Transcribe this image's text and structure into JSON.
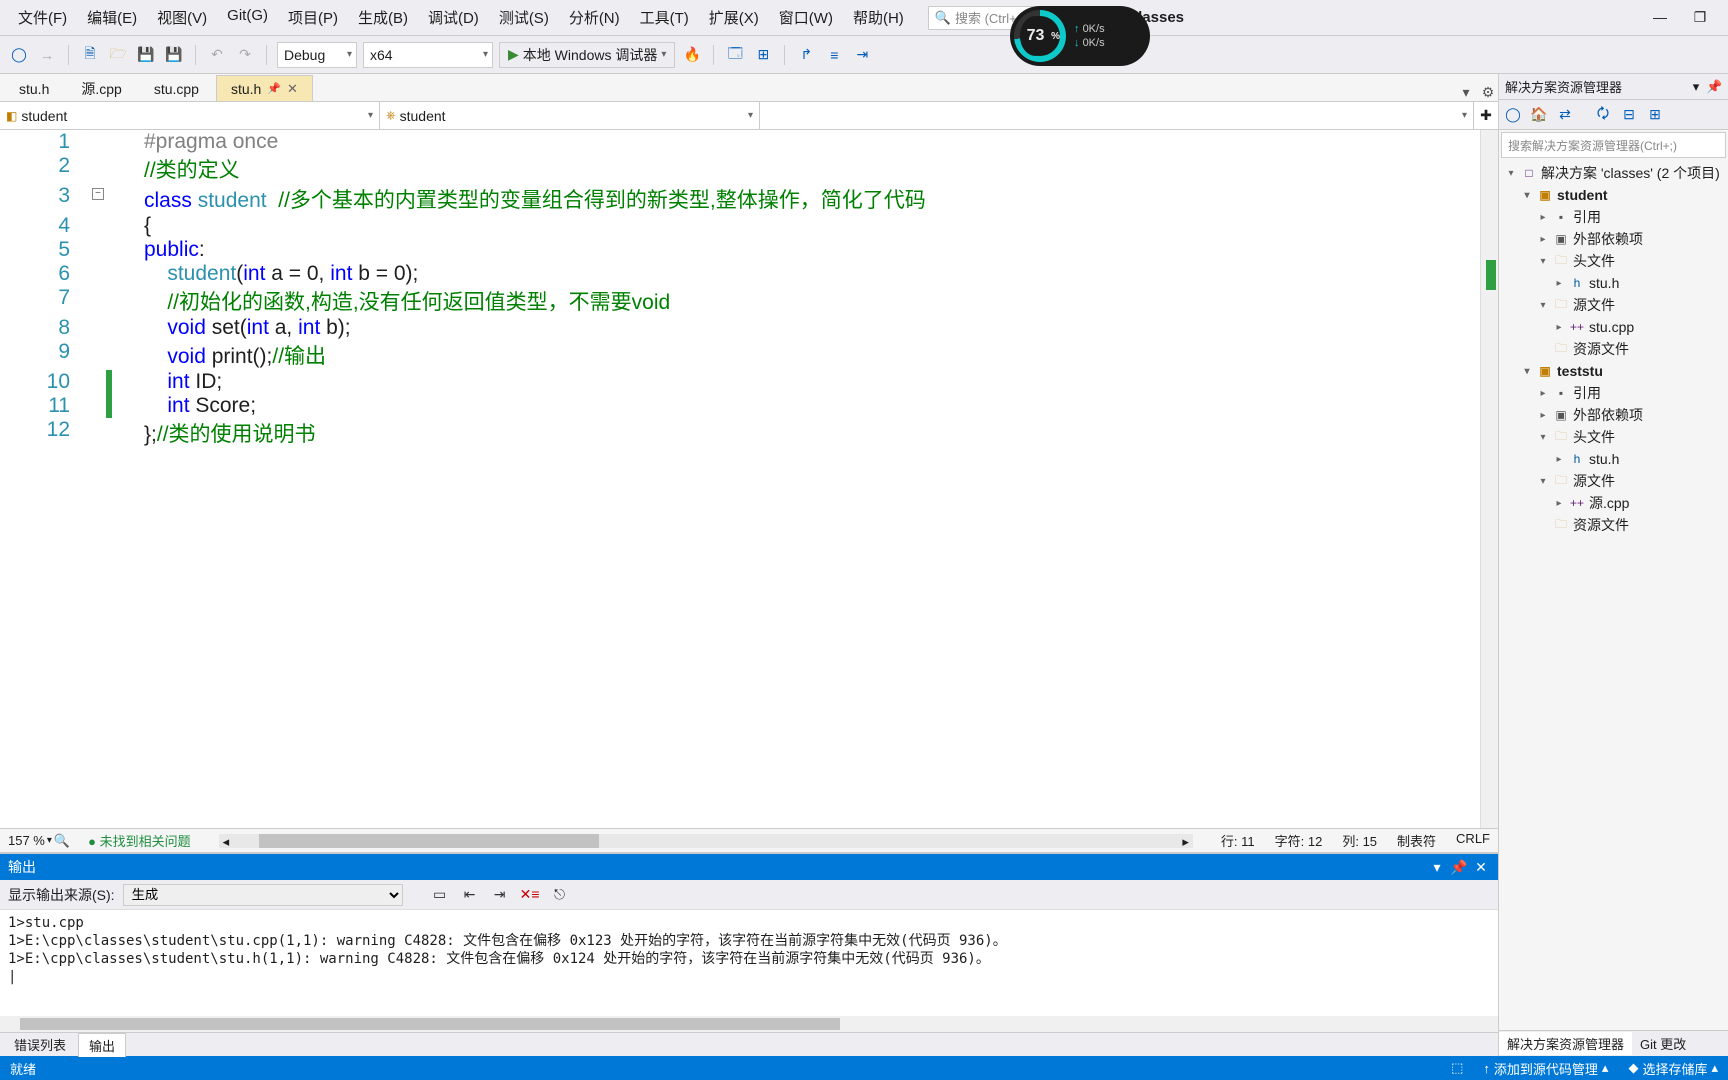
{
  "menu": [
    "文件(F)",
    "编辑(E)",
    "视图(V)",
    "Git(G)",
    "项目(P)",
    "生成(B)",
    "调试(D)",
    "测试(S)",
    "分析(N)",
    "工具(T)",
    "扩展(X)",
    "窗口(W)",
    "帮助(H)"
  ],
  "search_placeholder": "搜索 (Ctrl+Q)",
  "solution_name": "classes",
  "toolbar": {
    "config": "Debug",
    "platform": "x64",
    "debug_label": "本地 Windows 调试器"
  },
  "perf": {
    "pct": "73",
    "pct_unit": "%",
    "up": "0K/s",
    "down": "0K/s"
  },
  "editor_tabs": [
    {
      "label": "stu.h",
      "active": false
    },
    {
      "label": "源.cpp",
      "active": false
    },
    {
      "label": "stu.cpp",
      "active": false
    },
    {
      "label": "stu.h",
      "active": true
    }
  ],
  "nav": {
    "left": "student",
    "mid": "student",
    "right": ""
  },
  "code_lines": [
    {
      "n": 1,
      "html": "<span class='pp'>#pragma once</span>"
    },
    {
      "n": 2,
      "html": "<span class='com'>//类的定义</span>"
    },
    {
      "n": 3,
      "fold": true,
      "html": "<span class='kw'>class</span> <span class='type'>student</span>  <span class='com'>//多个基本的内置类型的变量组合得到的新类型,整体操作，简化了代码</span>"
    },
    {
      "n": 4,
      "html": "{"
    },
    {
      "n": 5,
      "html": "<span class='kw'>public</span>:"
    },
    {
      "n": 6,
      "html": "    <span class='type'>student</span>(<span class='kw'>int</span> a = 0, <span class='kw'>int</span> b = 0);"
    },
    {
      "n": 7,
      "html": "    <span class='com'>//初始化的函数,构造,没有任何返回值类型，不需要void</span>"
    },
    {
      "n": 8,
      "html": "    <span class='kw'>void</span> set(<span class='kw'>int</span> a, <span class='kw'>int</span> b);"
    },
    {
      "n": 9,
      "html": "    <span class='kw'>void</span> print();<span class='com'>//输出</span>"
    },
    {
      "n": 10,
      "change": true,
      "html": "    <span class='kw'>int</span> ID;"
    },
    {
      "n": 11,
      "change": true,
      "html": "    <span class='kw'>int</span> Score;"
    },
    {
      "n": 12,
      "html": "};<span class='com'>//类的使用说明书</span>"
    }
  ],
  "estatus": {
    "zoom": "157 %",
    "issues": "未找到相关问题",
    "line": "行: 11",
    "char": "字符: 12",
    "col": "列: 15",
    "ins": "制表符",
    "enc": "CRLF"
  },
  "output": {
    "title": "输出",
    "src_label": "显示输出来源(S):",
    "src_value": "生成",
    "lines": [
      "1>stu.cpp",
      "1>E:\\cpp\\classes\\student\\stu.cpp(1,1): warning C4828: 文件包含在偏移 0x123 处开始的字符，该字符在当前源字符集中无效(代码页 936)。",
      "1>E:\\cpp\\classes\\student\\stu.h(1,1): warning C4828: 文件包含在偏移 0x124 处开始的字符，该字符在当前源字符集中无效(代码页 936)。",
      "|"
    ]
  },
  "bottom_tabs": [
    {
      "label": "错误列表",
      "active": false
    },
    {
      "label": "输出",
      "active": true
    }
  ],
  "se": {
    "title": "解决方案资源管理器",
    "search": "搜索解决方案资源管理器(Ctrl+;)",
    "root": "解决方案 'classes' (2 个项目)",
    "tree": [
      {
        "d": 0,
        "arr": "▾",
        "ico": "□",
        "cls": "ico-sol",
        "label": "解决方案 'classes' (2 个项目)"
      },
      {
        "d": 1,
        "arr": "▾",
        "ico": "▣",
        "cls": "ico-proj",
        "label": "student",
        "bold": true
      },
      {
        "d": 2,
        "arr": "▸",
        "ico": "▪",
        "cls": "ico-ref",
        "label": "引用"
      },
      {
        "d": 2,
        "arr": "▸",
        "ico": "▣",
        "cls": "ico-ref",
        "label": "外部依赖项"
      },
      {
        "d": 2,
        "arr": "▾",
        "ico": "🗀",
        "cls": "ico-fold",
        "label": "头文件"
      },
      {
        "d": 3,
        "arr": "▸",
        "ico": "h",
        "cls": "ico-h",
        "label": "stu.h"
      },
      {
        "d": 2,
        "arr": "▾",
        "ico": "🗀",
        "cls": "ico-fold",
        "label": "源文件"
      },
      {
        "d": 3,
        "arr": "▸",
        "ico": "++",
        "cls": "ico-cpp",
        "label": "stu.cpp"
      },
      {
        "d": 2,
        "arr": "",
        "ico": "🗀",
        "cls": "ico-fold",
        "label": "资源文件"
      },
      {
        "d": 1,
        "arr": "▾",
        "ico": "▣",
        "cls": "ico-proj",
        "label": "teststu",
        "bold": true
      },
      {
        "d": 2,
        "arr": "▸",
        "ico": "▪",
        "cls": "ico-ref",
        "label": "引用"
      },
      {
        "d": 2,
        "arr": "▸",
        "ico": "▣",
        "cls": "ico-ref",
        "label": "外部依赖项"
      },
      {
        "d": 2,
        "arr": "▾",
        "ico": "🗀",
        "cls": "ico-fold",
        "label": "头文件"
      },
      {
        "d": 3,
        "arr": "▸",
        "ico": "h",
        "cls": "ico-h",
        "label": "stu.h"
      },
      {
        "d": 2,
        "arr": "▾",
        "ico": "🗀",
        "cls": "ico-fold",
        "label": "源文件"
      },
      {
        "d": 3,
        "arr": "▸",
        "ico": "++",
        "cls": "ico-cpp",
        "label": "源.cpp"
      },
      {
        "d": 2,
        "arr": "",
        "ico": "🗀",
        "cls": "ico-fold",
        "label": "资源文件"
      }
    ],
    "bottom": [
      {
        "label": "解决方案资源管理器",
        "active": true
      },
      {
        "label": "Git 更改",
        "active": false
      }
    ]
  },
  "statusbar": {
    "ready": "就绪",
    "src_ctrl": "添加到源代码管理",
    "repo": "选择存储库"
  }
}
